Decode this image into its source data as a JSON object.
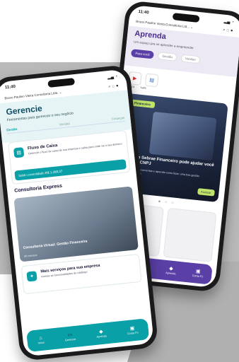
{
  "back_phone": {
    "status_time": "11:40",
    "business_name": "Bruno Paulino Vieira Consultoria Ltd... ⌄",
    "title": "Aprenda",
    "subtitle": "Um espaço pra se aprender a empreender",
    "tabs": [
      "Para você",
      "Gestão",
      "Vendas"
    ],
    "chips": [
      {
        "icon": "play-icon",
        "label": "Ouça"
      },
      {
        "icon": "read-icon",
        "label": "Leia"
      }
    ],
    "hero": {
      "tag": "Financeiro",
      "title": "Como o Sebrae Financeiro pode ajudar você e o seu CNPJ",
      "text": "Conheça as ferramentas e aprenda como fazer uma boa gestão do seu negócio",
      "button": "Acessar"
    },
    "nav": [
      {
        "icon": "⌂",
        "label": "Início"
      },
      {
        "icon": "▭",
        "label": "Gerencie"
      },
      {
        "icon": "◆",
        "label": "Aprenda"
      },
      {
        "icon": "▣",
        "label": "Conta PJ"
      }
    ]
  },
  "front_phone": {
    "status_time": "11:40",
    "business_name": "Bruno Paulino Vieira Consultoria Ltda. ⌄",
    "title": "Gerencie",
    "subtitle": "Ferramentas para gerenciar o seu negócio",
    "tabs": [
      "Gestão",
      "Vendas",
      "Finanças"
    ],
    "cash_flow": {
      "title": "Fluxo de Caixa",
      "description": "Gerencie o fluxo de caixa de sua empresa e saiba para onde vai o seu dinheiro",
      "balance": "Saldo consolidado   R$ 1.289,37"
    },
    "section_title": "Consultoria Express",
    "consult_card": {
      "title": "Consultoria Virtual: Gestão Financeira",
      "meta": "30 minutos"
    },
    "services_card": {
      "title": "Mais serviços para sua empresa",
      "description": "Acesse as funcionalidades do catálogo"
    },
    "nav": [
      {
        "icon": "⌂",
        "label": "Início"
      },
      {
        "icon": "▭",
        "label": "Gerencie"
      },
      {
        "icon": "◆",
        "label": "Aprenda"
      },
      {
        "icon": "▣",
        "label": "Conta PJ"
      }
    ]
  }
}
